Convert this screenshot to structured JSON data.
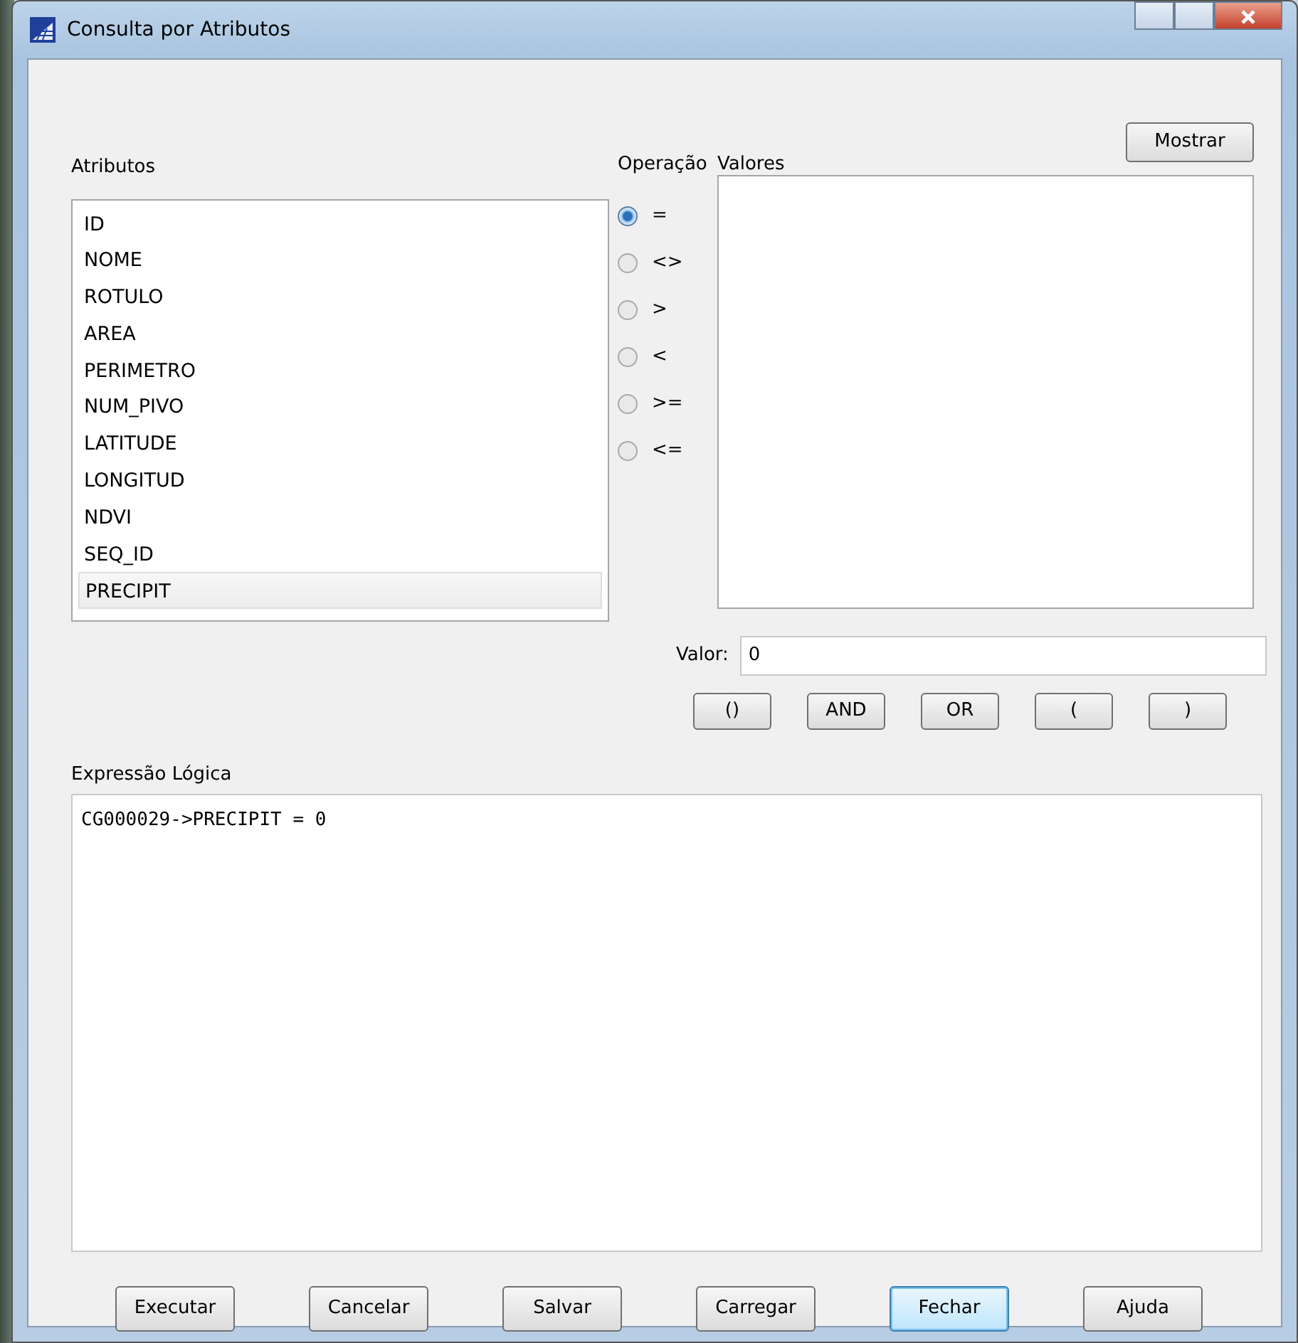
{
  "window": {
    "title": "Consulta por Atributos"
  },
  "attributes": {
    "label": "Atributos",
    "items": [
      {
        "text": "ID",
        "selected": false
      },
      {
        "text": "NOME",
        "selected": false
      },
      {
        "text": "ROTULO",
        "selected": false
      },
      {
        "text": "AREA",
        "selected": false
      },
      {
        "text": "PERIMETRO",
        "selected": false
      },
      {
        "text": "NUM_PIVO",
        "selected": false
      },
      {
        "text": "LATITUDE",
        "selected": false
      },
      {
        "text": "LONGITUD",
        "selected": false
      },
      {
        "text": "NDVI",
        "selected": false
      },
      {
        "text": "SEQ_ID",
        "selected": false
      },
      {
        "text": "PRECIPIT",
        "selected": true
      }
    ]
  },
  "operation": {
    "label": "Operação",
    "options": [
      {
        "text": "=",
        "selected": true
      },
      {
        "text": "<>",
        "selected": false
      },
      {
        "text": ">",
        "selected": false
      },
      {
        "text": "<",
        "selected": false
      },
      {
        "text": ">=",
        "selected": false
      },
      {
        "text": "<=",
        "selected": false
      }
    ]
  },
  "values": {
    "label": "Valores",
    "button": "Mostrar"
  },
  "value_field": {
    "label": "Valor:",
    "value": "0"
  },
  "logic_buttons": [
    "()",
    "AND",
    "OR",
    "(",
    ")"
  ],
  "expression": {
    "label": "Expressão Lógica",
    "value": "CG000029->PRECIPIT = 0"
  },
  "buttons": [
    {
      "text": "Executar",
      "default": false
    },
    {
      "text": "Cancelar",
      "default": false
    },
    {
      "text": "Salvar",
      "default": false
    },
    {
      "text": "Carregar",
      "default": false
    },
    {
      "text": "Fechar",
      "default": true
    },
    {
      "text": "Ajuda",
      "default": false
    }
  ]
}
